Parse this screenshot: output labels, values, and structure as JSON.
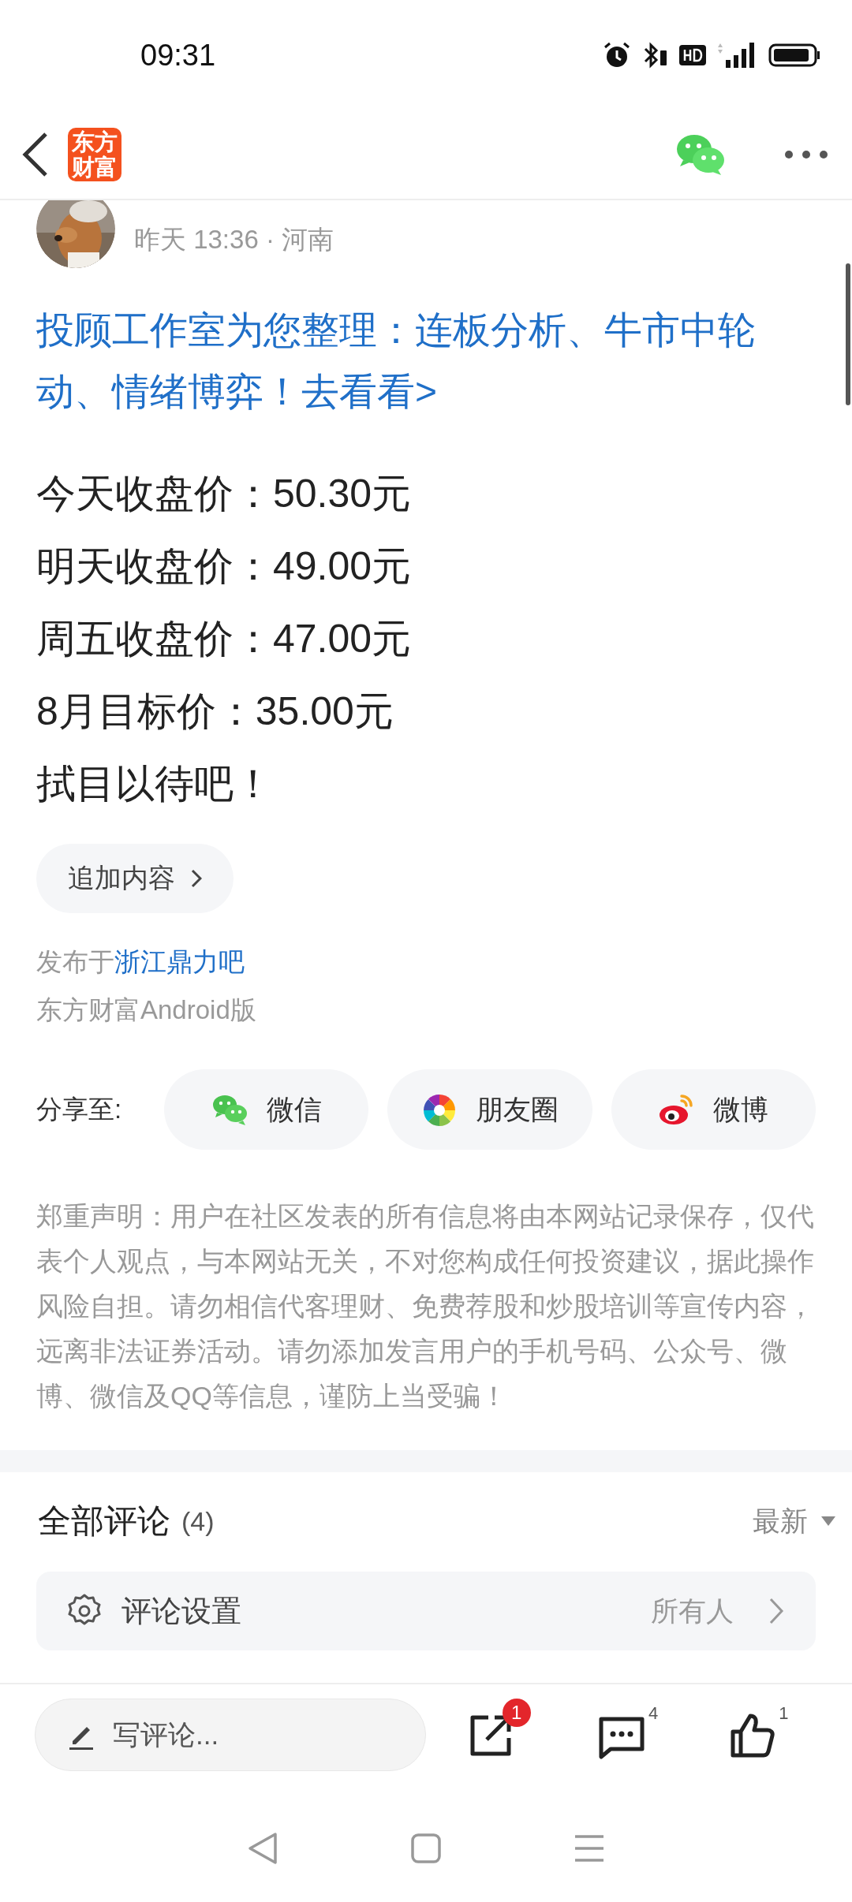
{
  "status_bar": {
    "time": "09:31"
  },
  "header": {
    "logo_text": "东方财富"
  },
  "post": {
    "meta": "昨天 13:36 · 河南",
    "headline": "投顾工作室为您整理：连板分析、牛市中轮动、情绪博弈！去看看>",
    "lines": [
      "今天收盘价：50.30元",
      "明天收盘价：49.00元",
      "周五收盘价：47.00元",
      "8月目标价：35.00元",
      "拭目以待吧！"
    ],
    "append_button": "追加内容",
    "forum_prefix": "发布于",
    "forum_link": "浙江鼎力吧",
    "client": "东方财富Android版"
  },
  "share": {
    "label": "分享至:",
    "targets": [
      {
        "kind": "wechat",
        "label": "微信"
      },
      {
        "kind": "moments",
        "label": "朋友圈"
      },
      {
        "kind": "weibo",
        "label": "微博"
      }
    ]
  },
  "disclaimer": "郑重声明：用户在社区发表的所有信息将由本网站记录保存，仅代表个人观点，与本网站无关，不对您构成任何投资建议，据此操作风险自担。请勿相信代客理财、免费荐股和炒股培训等宣传内容，远离非法证券活动。请勿添加发言用户的手机号码、公众号、微博、微信及QQ等信息，谨防上当受骗！",
  "comments": {
    "title": "全部评论",
    "count": "(4)",
    "sort": "最新",
    "settings": {
      "label": "评论设置",
      "value": "所有人"
    }
  },
  "bottom_bar": {
    "placeholder": "写评论...",
    "share_badge": "1",
    "comment_count": "4",
    "like_count": "1"
  }
}
